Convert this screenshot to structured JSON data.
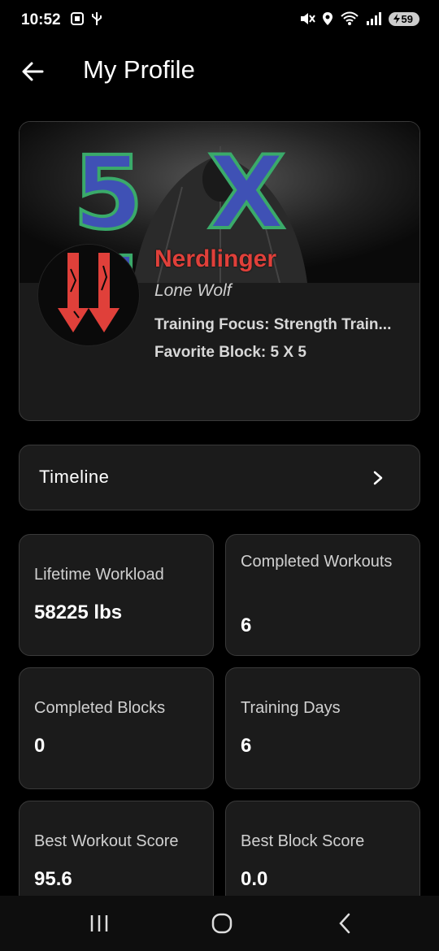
{
  "status": {
    "time": "10:52",
    "battery": "59",
    "network": "6"
  },
  "header": {
    "title": "My Profile"
  },
  "profile": {
    "banner_text": "5 X 5",
    "username": "Nerdlinger",
    "title": "Lone Wolf",
    "training_focus": "Training Focus: Strength Train...",
    "favorite_block": "Favorite Block: 5 X 5"
  },
  "timeline": {
    "label": "Timeline"
  },
  "stats": [
    {
      "label": "Lifetime Workload",
      "value": "58225 lbs"
    },
    {
      "label": "Completed Workouts",
      "value": "6"
    },
    {
      "label": "Completed Blocks",
      "value": "0"
    },
    {
      "label": "Training Days",
      "value": "6"
    },
    {
      "label": "Best Workout Score",
      "value": "95.6"
    },
    {
      "label": "Best Block Score",
      "value": "0.0"
    }
  ],
  "colors": {
    "accent_red": "#e0403a",
    "card_bg": "#1b1b1b",
    "banner_blue": "#3f51b5",
    "banner_green": "#3aaa6a"
  }
}
